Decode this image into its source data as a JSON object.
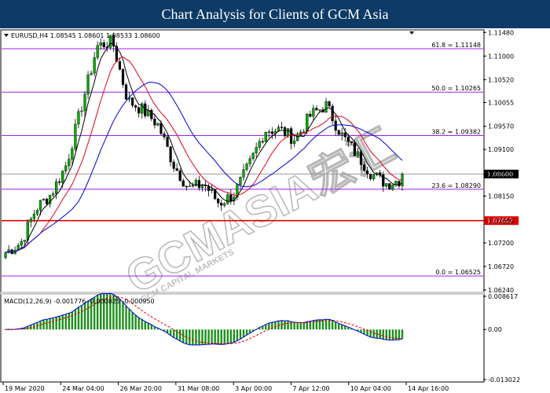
{
  "header": {
    "title": "Chart Analysis for Clients of GCM Asia"
  },
  "info": {
    "symbol_line": "EURUSD,H4  1.08545 1.08601 1.08533 1.08600",
    "macd_line": "MACD(12,26,9) -0.001776 -0.000825 -0.000950"
  },
  "watermark": {
    "main": "GCMASIA宏汇",
    "sub": "GCM CAPITAL MARKETS"
  },
  "colors": {
    "bull": "#00aa00",
    "bear": "#000000",
    "ma_fast": "#000000",
    "ma_mid": "#e0001a",
    "ma_slow": "#0000dd",
    "fib": "#a020f0",
    "support": "#e00000",
    "current": "#000000",
    "macd_hist": "#1d8f1d",
    "macd_line": "#0000dd",
    "macd_signal": "#e00000"
  },
  "chart_data": [
    {
      "type": "candlestick",
      "symbol": "EURUSD",
      "timeframe": "H4",
      "ylim": [
        1.0624,
        1.115
      ],
      "y_ticks": [
        "1.11480",
        "1.11000",
        "1.10520",
        "1.10055",
        "1.09570",
        "1.09100",
        "1.08600",
        "1.08150",
        "1.07650",
        "1.07200",
        "1.06720",
        "1.06240"
      ],
      "x_labels": [
        "19 Mar 2020",
        "24 Mar 04:00",
        "26 Mar 20:00",
        "31 Mar 08:00",
        "3 Apr 00:00",
        "7 Apr 12:00",
        "10 Apr 04:00",
        "14 Apr 16:00"
      ],
      "anchor_prices": [
        1.07,
        1.072,
        1.079,
        1.082,
        1.088,
        1.1,
        1.112,
        1.113,
        1.101,
        1.099,
        1.096,
        1.088,
        1.083,
        1.084,
        1.08,
        1.082,
        1.088,
        1.095,
        1.095,
        1.093,
        1.098,
        1.1,
        1.094,
        1.09,
        1.086,
        1.084,
        1.085
      ],
      "current_price": 1.086,
      "current_price_label": "1.08600",
      "fibonacci": [
        {
          "label": "61.8 = 1.11148",
          "value": 1.11148
        },
        {
          "label": "50.0 = 1.10265",
          "value": 1.10265
        },
        {
          "label": "38.2 = 1.09382",
          "value": 1.09382
        },
        {
          "label": "23.6 = 1.08290",
          "value": 1.0829
        },
        {
          "label": "0.0 = 1.06525",
          "value": 1.06525
        }
      ],
      "support": {
        "value": 1.07652,
        "label": "1.07652"
      }
    },
    {
      "type": "macd",
      "params": "12,26,9",
      "values": {
        "macd": -0.001776,
        "signal": -0.000825,
        "histogram": -0.00095
      },
      "ylim": [
        -0.013022,
        0.008617
      ],
      "y_ticks": [
        "0.008617",
        "0.00",
        "-0.013022"
      ]
    }
  ]
}
